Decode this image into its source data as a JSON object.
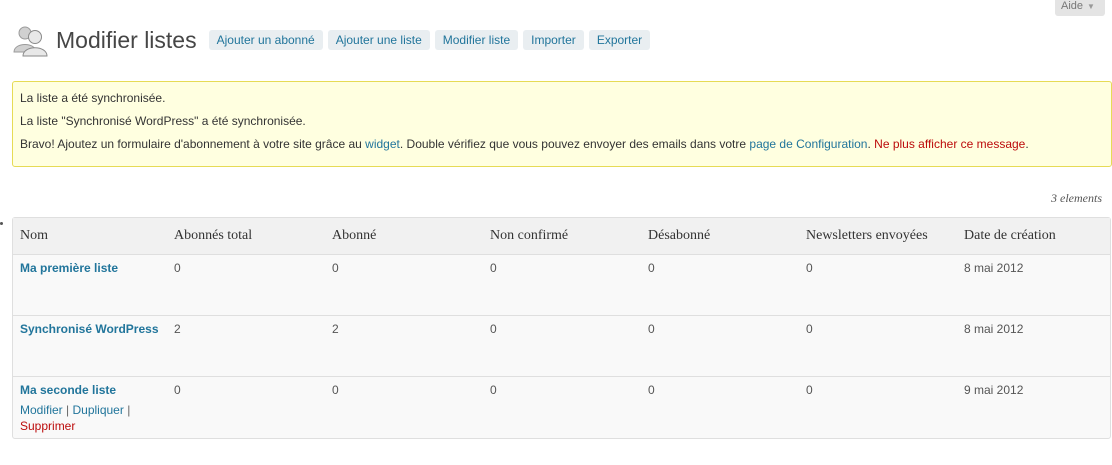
{
  "help": {
    "label": "Aide",
    "arrow": "▼"
  },
  "header": {
    "icon": "users-icon",
    "title": "Modifier listes",
    "buttons": [
      "Ajouter un abonné",
      "Ajouter une liste",
      "Modifier liste",
      "Importer",
      "Exporter"
    ]
  },
  "notice": {
    "line1": "La liste a été synchronisée.",
    "line2": "La liste \"Synchronisé WordPress\" a été synchronisée.",
    "line3_part1": "Bravo! Ajoutez un formulaire d'abonnement à votre site grâce au ",
    "line3_link1": "widget",
    "line3_part2": ". Double vérifiez que vous pouvez envoyer des emails dans votre ",
    "line3_link2": "page de Configuration",
    "line3_part3": ". ",
    "line3_dismiss": "Ne plus afficher ce message",
    "line3_part4": "."
  },
  "count": "3 elements",
  "table": {
    "columns": [
      "Nom",
      "Abonnés total",
      "Abonné",
      "Non confirmé",
      "Désabonné",
      "Newsletters envoyées",
      "Date de création"
    ],
    "rows": [
      {
        "name": "Ma première liste",
        "total": "0",
        "subscribed": "0",
        "unconfirmed": "0",
        "unsubscribed": "0",
        "newsletters": "0",
        "date": "8 mai 2012"
      },
      {
        "name": "Synchronisé WordPress",
        "total": "2",
        "subscribed": "2",
        "unconfirmed": "0",
        "unsubscribed": "0",
        "newsletters": "0",
        "date": "8 mai 2012"
      },
      {
        "name": "Ma seconde liste",
        "total": "0",
        "subscribed": "0",
        "unconfirmed": "0",
        "unsubscribed": "0",
        "newsletters": "0",
        "date": "9 mai 2012",
        "actions": {
          "edit": "Modifier",
          "sep1": " | ",
          "duplicate": "Dupliquer",
          "sep2": " |",
          "delete": "Supprimer"
        }
      }
    ]
  }
}
